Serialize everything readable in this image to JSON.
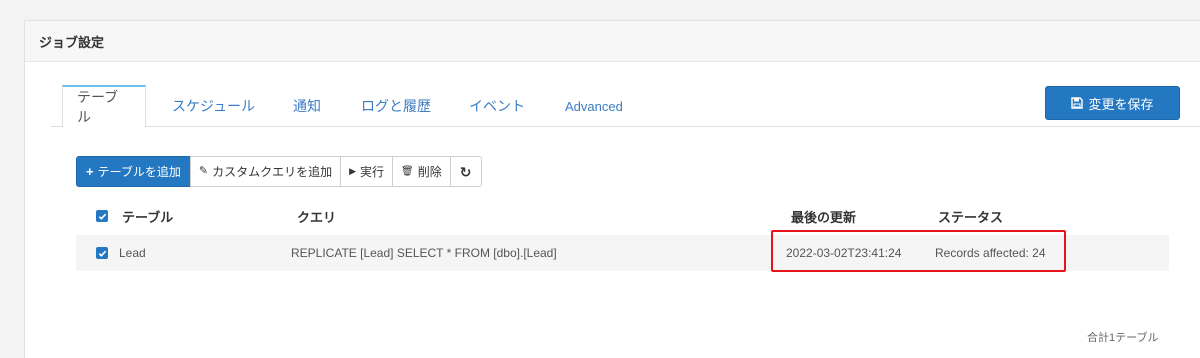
{
  "panel": {
    "title": "ジョブ設定"
  },
  "tabs": [
    {
      "label": "テーブル",
      "active": true
    },
    {
      "label": "スケジュール"
    },
    {
      "label": "通知"
    },
    {
      "label": "ログと履歴"
    },
    {
      "label": "イベント"
    },
    {
      "label": "Advanced"
    }
  ],
  "save_button": {
    "label": "変更を保存",
    "icon": "floppy-disk-icon"
  },
  "toolbar": {
    "add_table": {
      "icon": "+",
      "label": "テーブルを追加"
    },
    "add_custom_query": {
      "icon": "✎",
      "label": "カスタムクエリを追加"
    },
    "run": {
      "icon": "▶",
      "label": "実行"
    },
    "delete": {
      "icon": "🗑",
      "label": "削除"
    },
    "refresh": {
      "icon": "↻"
    }
  },
  "table": {
    "headers": {
      "table": "テーブル",
      "query": "クエリ",
      "last_updated": "最後の更新",
      "status": "ステータス"
    },
    "rows": [
      {
        "checked": true,
        "table": "Lead",
        "query": "REPLICATE [Lead] SELECT * FROM [dbo].[Lead]",
        "last_updated": "2022-03-02T23:41:24",
        "status": "Records affected: 24"
      }
    ]
  },
  "footer": {
    "total": "合計1テーブル"
  },
  "colors": {
    "accent": "#2478c2",
    "highlight": "#e8131a",
    "tab_active_border": "#6cc4ec"
  }
}
